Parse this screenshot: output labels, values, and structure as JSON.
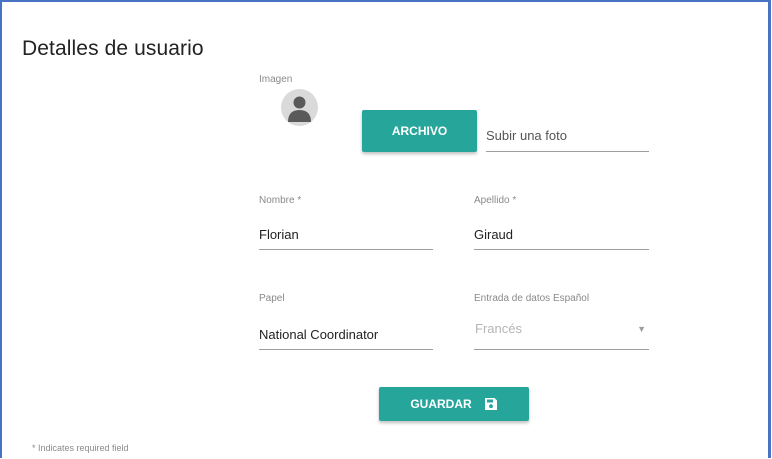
{
  "page": {
    "title": "Detalles de usuario",
    "footnote": "* Indicates required field"
  },
  "image": {
    "label": "Imagen",
    "avatar_icon": "user-silhouette",
    "file_button": "ARCHIVO",
    "file_placeholder": "Subir una foto"
  },
  "form": {
    "first_name": {
      "label": "Nombre *",
      "value": "Florian"
    },
    "last_name": {
      "label": "Apellido *",
      "value": "Giraud"
    },
    "role": {
      "label": "Papel",
      "value": "National Coordinator"
    },
    "data_entry": {
      "label": "Entrada de datos Español",
      "value": "Francés",
      "icon": "dropdown-caret"
    }
  },
  "actions": {
    "save_label": "GUARDAR",
    "save_icon": "floppy-disk"
  },
  "colors": {
    "accent": "#26a69a",
    "frame": "#4a72c4",
    "underline": "#9e9e9e",
    "label": "#8a8a8a"
  }
}
